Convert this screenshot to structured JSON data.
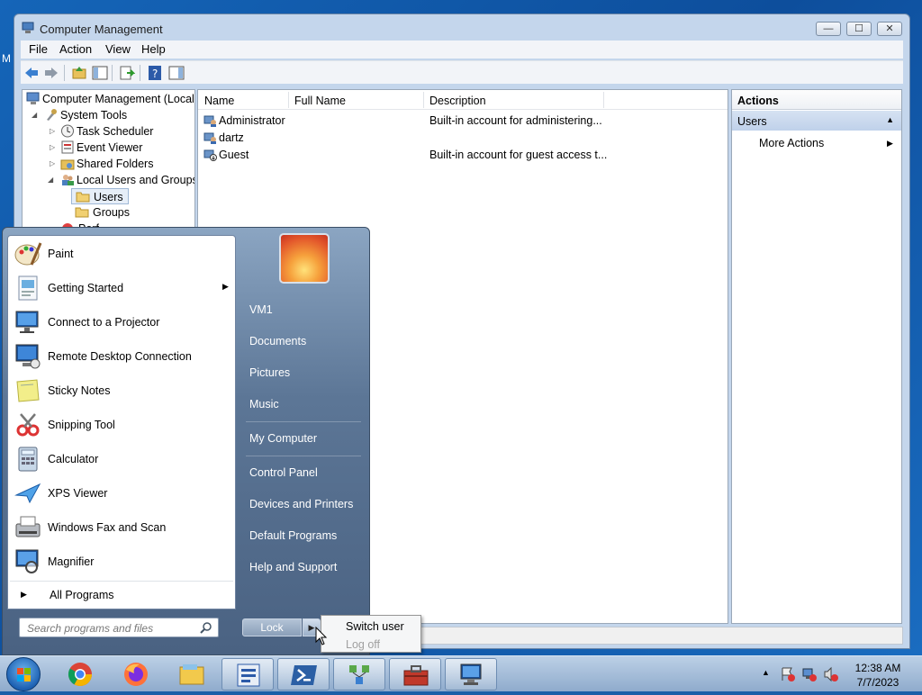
{
  "desktop": {
    "edge_text": "M"
  },
  "window": {
    "title": "Computer Management",
    "controls": {
      "minimize": "—",
      "maximize": "☐",
      "close": "✕"
    }
  },
  "menu": [
    "File",
    "Action",
    "View",
    "Help"
  ],
  "tree": {
    "items": [
      {
        "label": "Computer Management (Local",
        "indent": 0,
        "expander": ""
      },
      {
        "label": "System Tools",
        "indent": 1,
        "expander": "◢"
      },
      {
        "label": "Task Scheduler",
        "indent": 2,
        "expander": "▷"
      },
      {
        "label": "Event Viewer",
        "indent": 2,
        "expander": "▷"
      },
      {
        "label": "Shared Folders",
        "indent": 2,
        "expander": "▷"
      },
      {
        "label": "Local Users and Groups",
        "indent": 2,
        "expander": "◢"
      },
      {
        "label": "Users",
        "indent": 3,
        "expander": ""
      },
      {
        "label": "Groups",
        "indent": 3,
        "expander": ""
      },
      {
        "label": "Perf",
        "indent": 2,
        "expander": ""
      }
    ]
  },
  "list": {
    "columns": [
      "Name",
      "Full Name",
      "Description"
    ],
    "rows": [
      {
        "name": "Administrator",
        "full_name": "",
        "description": "Built-in account for administering..."
      },
      {
        "name": "dartz",
        "full_name": "",
        "description": ""
      },
      {
        "name": "Guest",
        "full_name": "",
        "description": "Built-in account for guest access t..."
      }
    ]
  },
  "actions": {
    "header": "Actions",
    "section": "Users",
    "section_arrow": "▲",
    "more": "More Actions",
    "more_arrow": "▶"
  },
  "start_menu": {
    "programs": [
      {
        "label": "Paint",
        "icon": "paint-icon",
        "submenu": false
      },
      {
        "label": "Getting Started",
        "icon": "getting-started-icon",
        "submenu": true
      },
      {
        "label": "Connect to a Projector",
        "icon": "projector-icon",
        "submenu": false
      },
      {
        "label": "Remote Desktop Connection",
        "icon": "remote-desktop-icon",
        "submenu": false
      },
      {
        "label": "Sticky Notes",
        "icon": "sticky-notes-icon",
        "submenu": false
      },
      {
        "label": "Snipping Tool",
        "icon": "snipping-tool-icon",
        "submenu": false
      },
      {
        "label": "Calculator",
        "icon": "calculator-icon",
        "submenu": false
      },
      {
        "label": "XPS Viewer",
        "icon": "xps-viewer-icon",
        "submenu": false
      },
      {
        "label": "Windows Fax and Scan",
        "icon": "fax-scan-icon",
        "submenu": false
      },
      {
        "label": "Magnifier",
        "icon": "magnifier-icon",
        "submenu": false
      }
    ],
    "submenu_arrow": "▶",
    "all_programs": "All Programs",
    "search_placeholder": "Search programs and files",
    "right_links": [
      "VM1",
      "Documents",
      "Pictures",
      "Music",
      "My Computer",
      "Control Panel",
      "Devices and Printers",
      "Default Programs",
      "Help and Support"
    ],
    "lock_label": "Lock",
    "lock_arrow": "▶"
  },
  "power_submenu": {
    "items": [
      {
        "label": "Switch user",
        "enabled": true
      },
      {
        "label": "Log off",
        "enabled": false
      }
    ]
  },
  "taskbar": {
    "pinned": [
      "chrome-icon",
      "firefox-icon",
      "explorer-icon",
      "computer-management-icon",
      "powershell-icon",
      "network-icon",
      "toolbox-icon",
      "remote-desktop-icon"
    ],
    "clock_time": "12:38 AM",
    "clock_date": "7/7/2023"
  },
  "colors": {
    "window_frame": "#c4d6ec",
    "selection": "#e6eef8",
    "start_right": "#5c7696",
    "desktop": "#1565b8"
  }
}
